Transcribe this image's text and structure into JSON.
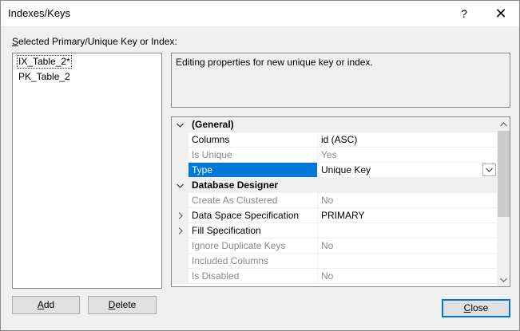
{
  "window": {
    "title": "Indexes/Keys",
    "help": "?",
    "close": "✕"
  },
  "section_label": {
    "first": "S",
    "rest": "elected Primary/Unique Key or Index:"
  },
  "keys": [
    "IX_Table_2*",
    "PK_Table_2"
  ],
  "description": "Editing properties for new unique key or index.",
  "grid": {
    "rows": [
      {
        "type": "category",
        "name": "(General)",
        "expander": "collapse"
      },
      {
        "type": "prop",
        "name": "Columns",
        "value": "id (ASC)"
      },
      {
        "type": "prop",
        "name": "Is Unique",
        "value": "Yes",
        "dim": true
      },
      {
        "type": "prop",
        "name": "Type",
        "value": "Unique Key",
        "selected": true,
        "dropdown": true
      },
      {
        "type": "category",
        "name": "Database Designer",
        "expander": "collapse"
      },
      {
        "type": "prop",
        "name": "Create As Clustered",
        "value": "No",
        "dim": true
      },
      {
        "type": "prop",
        "name": "Data Space Specification",
        "value": "PRIMARY",
        "expander": "expand"
      },
      {
        "type": "prop",
        "name": "Fill Specification",
        "value": "",
        "expander": "expand"
      },
      {
        "type": "prop",
        "name": "Ignore Duplicate Keys",
        "value": "No",
        "dim": true
      },
      {
        "type": "prop",
        "name": "Included Columns",
        "value": "",
        "dim": true
      },
      {
        "type": "prop",
        "name": "Is Disabled",
        "value": "No",
        "dim": true
      }
    ]
  },
  "buttons": {
    "add": {
      "first": "A",
      "rest": "dd"
    },
    "delete": {
      "first": "D",
      "rest": "elete"
    },
    "close": {
      "first": "C",
      "rest": "lose"
    }
  },
  "colors": {
    "selection": "#0078d7",
    "category_bg": "#f0f0f0"
  }
}
